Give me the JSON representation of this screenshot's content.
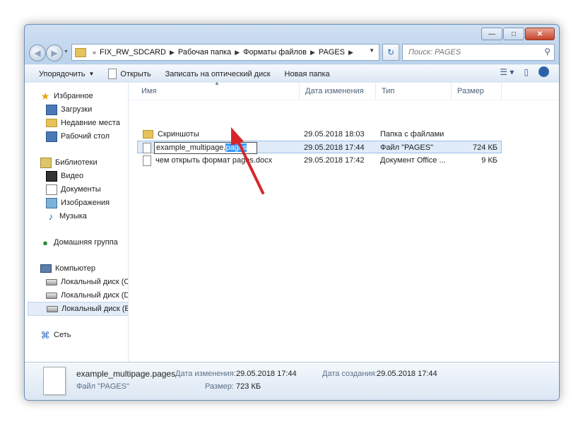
{
  "window": {
    "caption_buttons": {
      "minimize": "—",
      "maximize": "□",
      "close": "✕"
    }
  },
  "nav": {
    "back_glyph": "◀",
    "forward_glyph": "▶",
    "breadcrumbs": [
      "FIX_RW_SDCARD",
      "Рабочая папка",
      "Форматы файлов",
      "PAGES"
    ],
    "prefix_glyph": "«",
    "search_placeholder": "Поиск: PAGES"
  },
  "toolbar": {
    "organize": "Упорядочить",
    "open": "Открыть",
    "burn": "Записать на оптический диск",
    "new_folder": "Новая папка"
  },
  "sidebar": {
    "favorites": "Избранное",
    "downloads": "Загрузки",
    "recent": "Недавние места",
    "desktop": "Рабочий стол",
    "libraries": "Библиотеки",
    "video": "Видео",
    "documents": "Документы",
    "images": "Изображения",
    "music": "Музыка",
    "homegroup": "Домашняя группа",
    "computer": "Компьютер",
    "disk_c": "Локальный диск (C",
    "disk_d": "Локальный диск (D",
    "disk_e": "Локальный диск (E:",
    "network": "Сеть"
  },
  "columns": {
    "name": "Имя",
    "date": "Дата изменения",
    "type": "Тип",
    "size": "Размер"
  },
  "files": [
    {
      "name": "Скриншоты",
      "date": "29.05.2018 18:03",
      "type": "Папка с файлами",
      "size": ""
    },
    {
      "name_base": "example_multipage.",
      "name_ext": "pages",
      "date": "29.05.2018 17:44",
      "type": "Файл \"PAGES\"",
      "size": "724 КБ"
    },
    {
      "name": "чем открыть формат pages.docx",
      "date": "29.05.2018 17:42",
      "type": "Документ Office ...",
      "size": "9 КБ"
    }
  ],
  "details": {
    "file_name": "example_multipage.pages",
    "file_type": "Файл \"PAGES\"",
    "modified_label": "Дата изменения:",
    "modified_value": "29.05.2018 17:44",
    "created_label": "Дата создания:",
    "created_value": "29.05.2018 17:44",
    "size_label": "Размер:",
    "size_value": "723 КБ"
  },
  "colors": {
    "selection": "#3399ff",
    "annotation_arrow": "#d9252a"
  }
}
